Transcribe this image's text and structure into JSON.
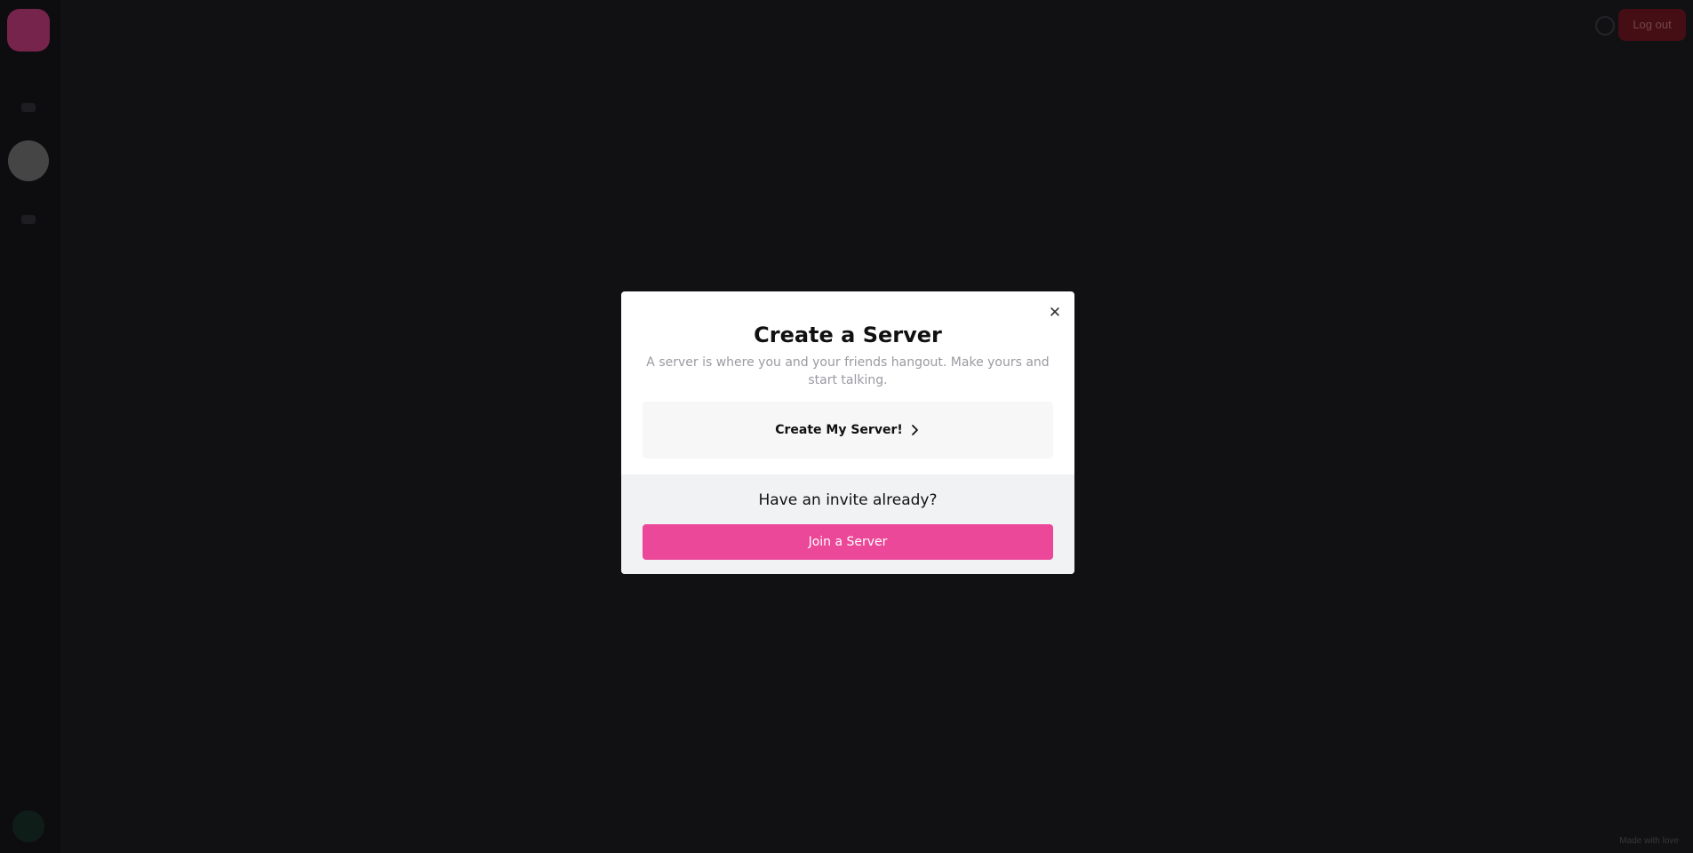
{
  "topbar": {
    "button_label": "Log out",
    "search_icon": "search-icon"
  },
  "footer": {
    "text": "Made with love"
  },
  "modal": {
    "title": "Create a Server",
    "subtitle": "A server is where you and your friends hangout. Make yours and start talking.",
    "create_label": "Create My Server!",
    "invite_prompt": "Have an invite already?",
    "join_label": "Join a Server",
    "close_icon": "close-icon",
    "chevron_icon": "chevron-right-icon"
  },
  "colors": {
    "accent": "#ec4899",
    "modal_bg": "#ffffff",
    "modal_footer_bg": "#f1f2f4",
    "app_bg": "#222226"
  }
}
